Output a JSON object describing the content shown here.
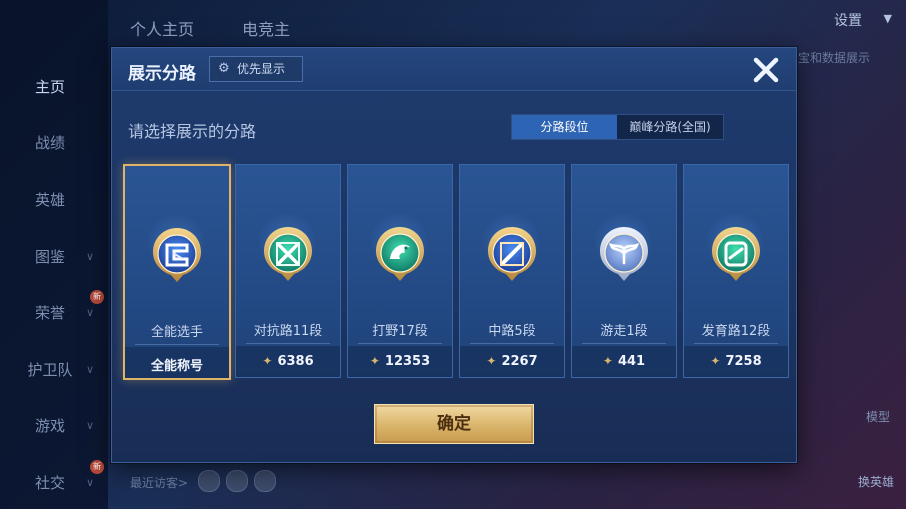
{
  "background": {
    "sidebar": [
      {
        "label": "主页",
        "active": true,
        "chevron": false,
        "badge": ""
      },
      {
        "label": "战绩",
        "active": false,
        "chevron": false,
        "badge": ""
      },
      {
        "label": "英雄",
        "active": false,
        "chevron": false,
        "badge": ""
      },
      {
        "label": "图鉴",
        "active": false,
        "chevron": true,
        "badge": ""
      },
      {
        "label": "荣誉",
        "active": false,
        "chevron": true,
        "badge": "新"
      },
      {
        "label": "护卫队",
        "active": false,
        "chevron": true,
        "badge": ""
      },
      {
        "label": "游戏",
        "active": false,
        "chevron": true,
        "badge": ""
      },
      {
        "label": "社交",
        "active": false,
        "chevron": true,
        "badge": "新"
      }
    ],
    "top_tabs": [
      "个人主页",
      "电竞主"
    ],
    "settings_label": "设置",
    "right_note": "宝和数据展示",
    "model_label": "模型",
    "switch_hero_label": "换英雄",
    "recent_visitors_label": "最近访客>"
  },
  "modal": {
    "title": "展示分路",
    "priority_button": "优先显示",
    "subtitle": "请选择展示的分路",
    "segments": [
      {
        "label": "分路段位",
        "active": true
      },
      {
        "label": "巅峰分路(全国)",
        "active": false
      }
    ],
    "cards": [
      {
        "name": "全能选手",
        "value": "全能称号",
        "points": null,
        "selected": true,
        "icon": "all-round-emblem-icon",
        "frame": "gold"
      },
      {
        "name": "对抗路11段",
        "value": "6386",
        "points": 6386,
        "selected": false,
        "icon": "clash-lane-emblem-icon",
        "frame": "green"
      },
      {
        "name": "打野17段",
        "value": "12353",
        "points": 12353,
        "selected": false,
        "icon": "jungle-dragon-emblem-icon",
        "frame": "green"
      },
      {
        "name": "中路5段",
        "value": "2267",
        "points": 2267,
        "selected": false,
        "icon": "mid-lane-emblem-icon",
        "frame": "gold"
      },
      {
        "name": "游走1段",
        "value": "441",
        "points": 441,
        "selected": false,
        "icon": "roam-wings-emblem-icon",
        "frame": "silver"
      },
      {
        "name": "发育路12段",
        "value": "7258",
        "points": 7258,
        "selected": false,
        "icon": "farm-lane-emblem-icon",
        "frame": "green"
      }
    ],
    "confirm_label": "确定",
    "colors": {
      "accent_gold": "#e0b468",
      "segment_active": "#2e64b4",
      "panel": "#1e3b6e"
    }
  }
}
